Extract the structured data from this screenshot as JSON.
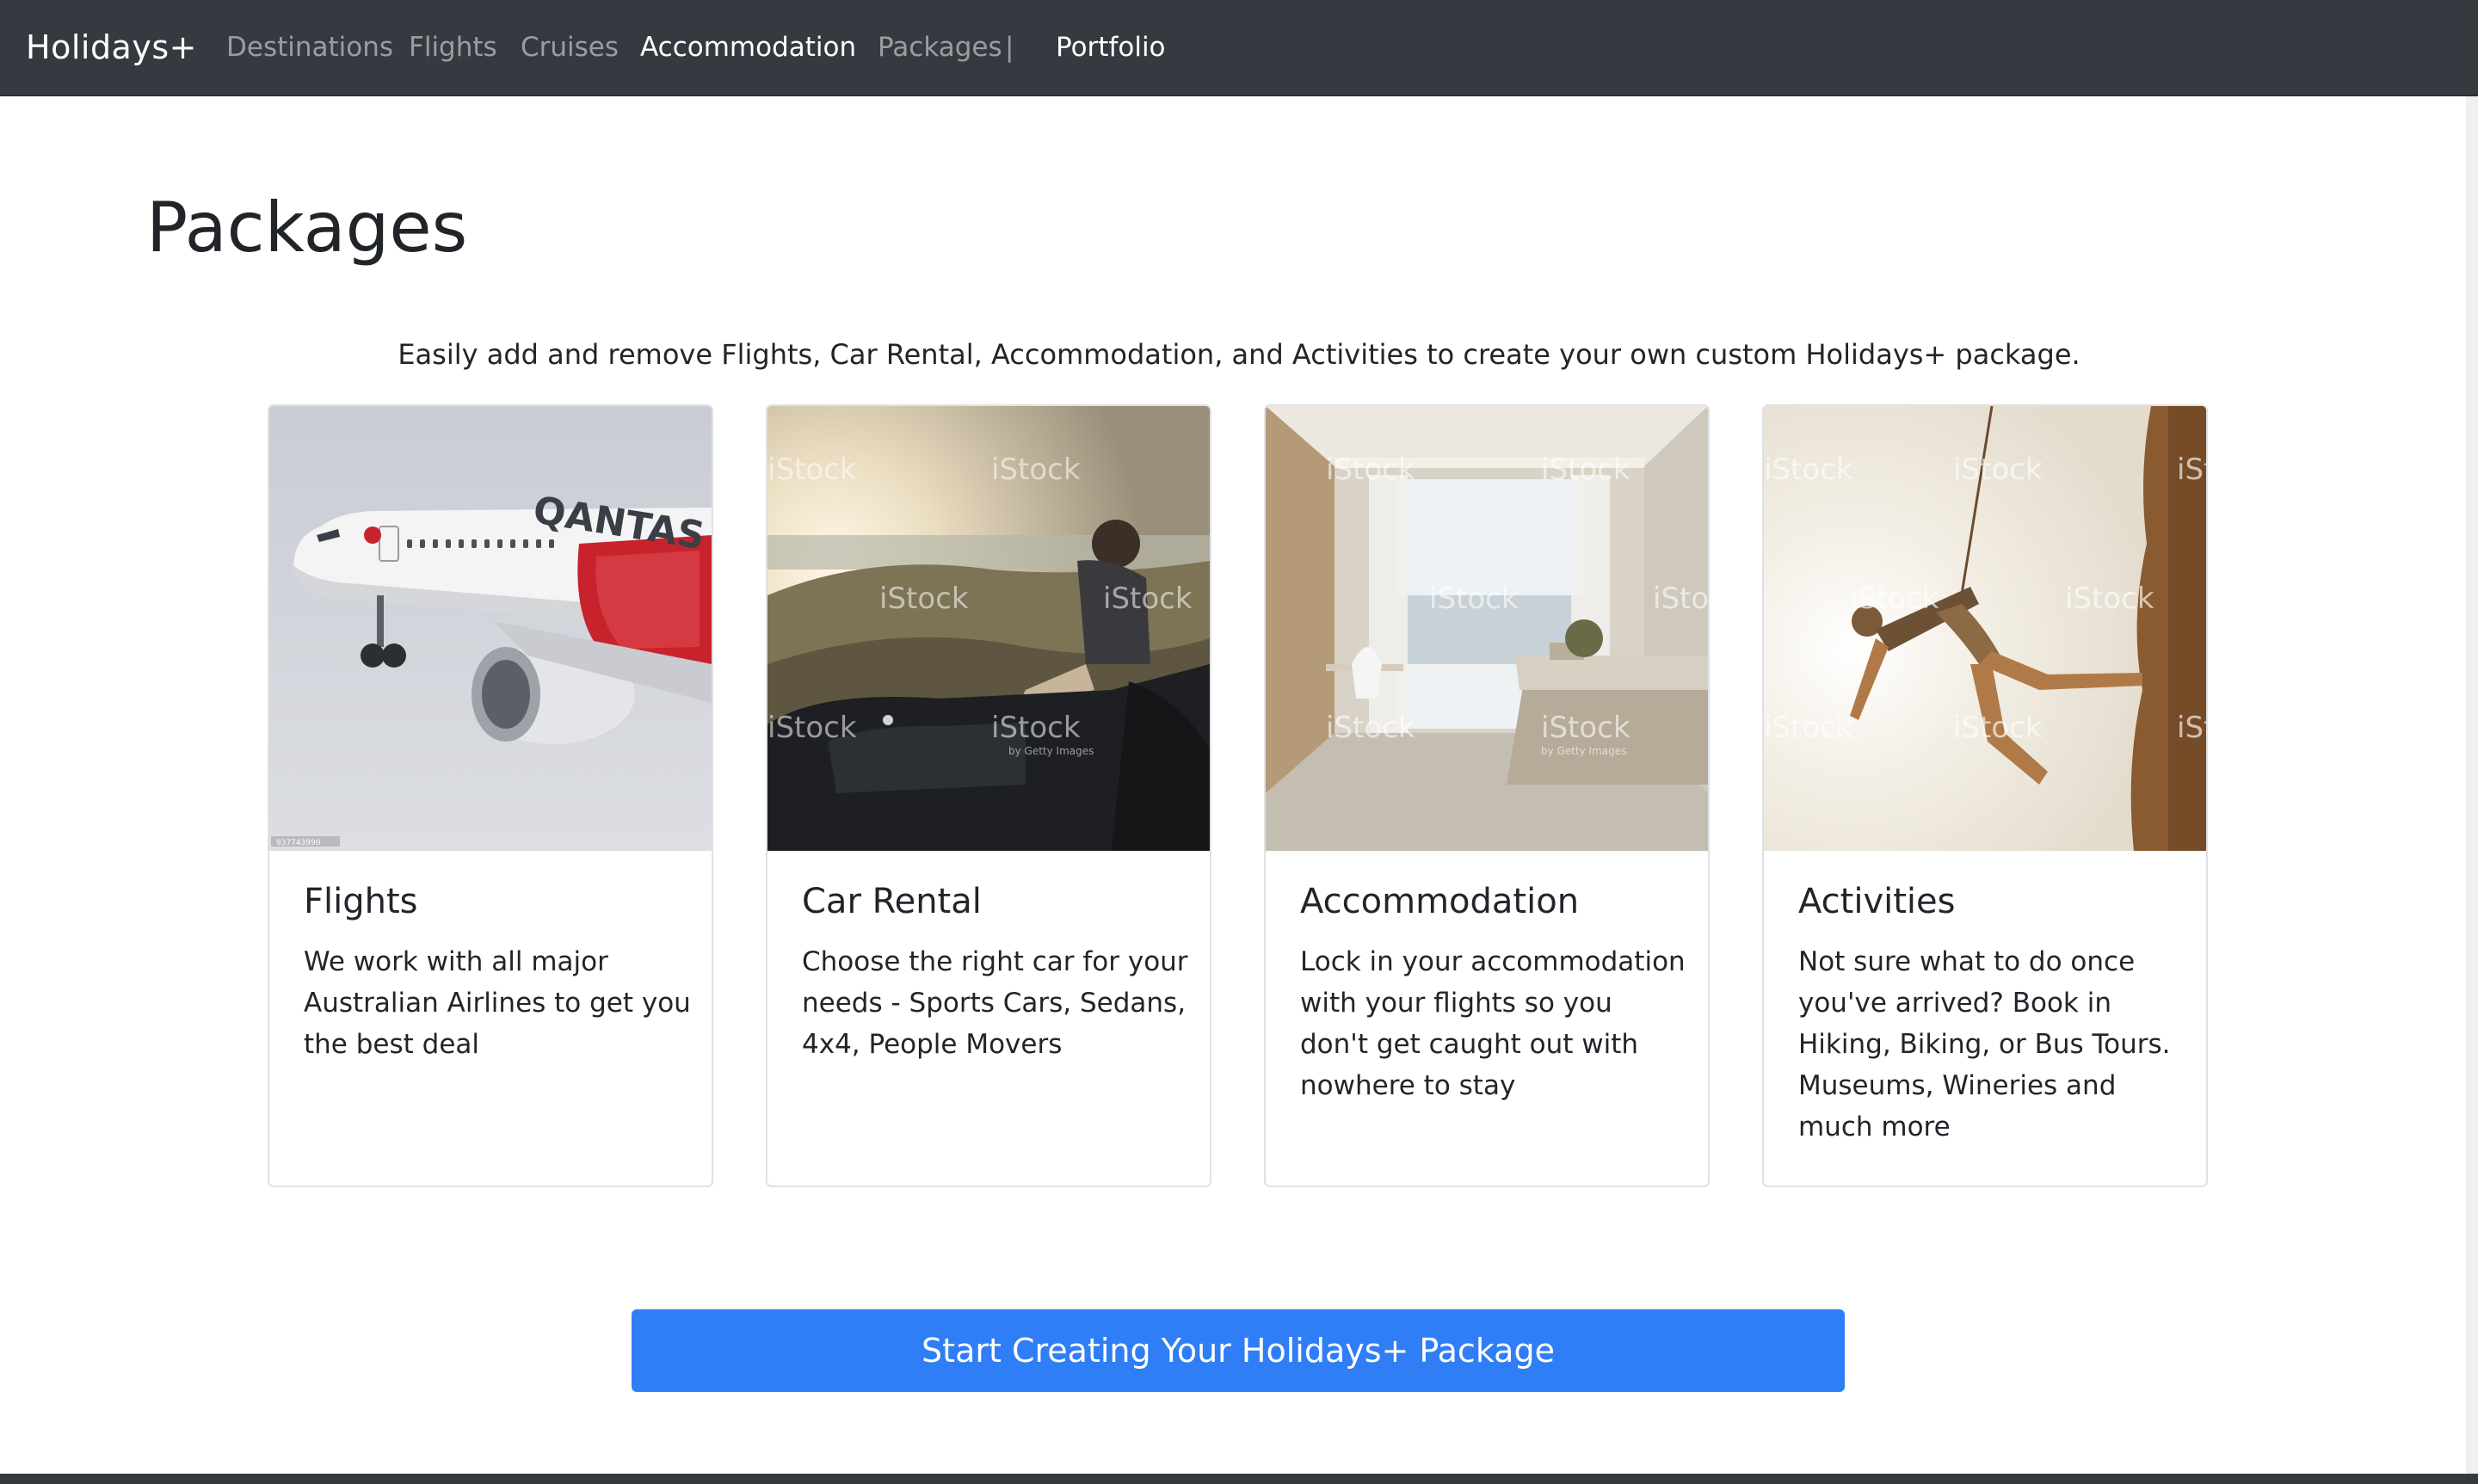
{
  "navbar": {
    "brand": "Holidays+",
    "items": [
      {
        "label": "Destinations",
        "active": false
      },
      {
        "label": "Flights",
        "active": false
      },
      {
        "label": "Cruises",
        "active": false
      },
      {
        "label": "Accommodation",
        "active": true
      },
      {
        "label": "Packages",
        "active": false
      },
      {
        "label": "Portfolio",
        "active": true
      }
    ],
    "separator": "|"
  },
  "page": {
    "title": "Packages",
    "intro": "Easily add and remove Flights, Car Rental, Accommodation, and Activities to create your own custom Holidays+ package."
  },
  "cards": [
    {
      "title": "Flights",
      "text": "We work with all major Australian Airlines to get you the best deal",
      "image_icon": "airplane-image",
      "image_text": "QANTAS",
      "image_code": "937743990"
    },
    {
      "title": "Car Rental",
      "text": "Choose the right car for your needs - Sports Cars, Sedans, 4x4, People Movers",
      "image_icon": "car-rental-image"
    },
    {
      "title": "Accommodation",
      "text": "Lock in your accommodation with your flights so you don't get caught out with nowhere to stay",
      "image_icon": "hotel-room-image"
    },
    {
      "title": "Activities",
      "text": "Not sure what to do once you've arrived? Book in Hiking, Biking, or Bus Tours. Museums, Wineries and much more",
      "image_icon": "climbing-image"
    }
  ],
  "watermark": {
    "brand": "iStock",
    "sub": "by Getty Images"
  },
  "cta": {
    "label": "Start Creating Your Holidays+ Package"
  },
  "colors": {
    "navbar_bg": "#343a40",
    "primary": "#2f7ef5",
    "text": "#212529"
  }
}
